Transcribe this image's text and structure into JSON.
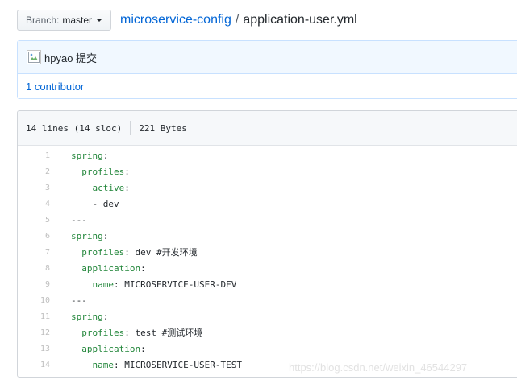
{
  "branch": {
    "prefix": "Branch:",
    "name": "master"
  },
  "breadcrumb": {
    "repo": "microservice-config",
    "separator": "/",
    "file": "application-user.yml"
  },
  "commit": {
    "author": "hpyao 提交",
    "contributors": "1 contributor"
  },
  "file_info": {
    "lines": "14 lines (14 sloc)",
    "size": "221 Bytes"
  },
  "code": [
    {
      "num": "1",
      "indent": "",
      "key": "spring",
      "rest": ":"
    },
    {
      "num": "2",
      "indent": "  ",
      "key": "profiles",
      "rest": ":"
    },
    {
      "num": "3",
      "indent": "    ",
      "key": "active",
      "rest": ":"
    },
    {
      "num": "4",
      "indent": "    ",
      "key": "",
      "rest": "- dev"
    },
    {
      "num": "5",
      "indent": "",
      "key": "",
      "rest": "---"
    },
    {
      "num": "6",
      "indent": "",
      "key": "spring",
      "rest": ":"
    },
    {
      "num": "7",
      "indent": "  ",
      "key": "profiles",
      "rest": ": dev #开发环境"
    },
    {
      "num": "8",
      "indent": "  ",
      "key": "application",
      "rest": ":"
    },
    {
      "num": "9",
      "indent": "    ",
      "key": "name",
      "rest": ": MICROSERVICE-USER-DEV"
    },
    {
      "num": "10",
      "indent": "",
      "key": "",
      "rest": "---"
    },
    {
      "num": "11",
      "indent": "",
      "key": "spring",
      "rest": ":"
    },
    {
      "num": "12",
      "indent": "  ",
      "key": "profiles",
      "rest": ": test #测试环境"
    },
    {
      "num": "13",
      "indent": "  ",
      "key": "application",
      "rest": ":"
    },
    {
      "num": "14",
      "indent": "    ",
      "key": "name",
      "rest": ": MICROSERVICE-USER-TEST"
    }
  ],
  "watermark": "https://blog.csdn.net/weixin_46544297"
}
